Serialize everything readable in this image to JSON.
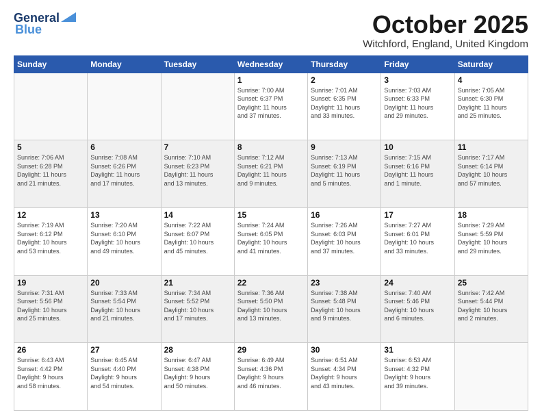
{
  "logo": {
    "line1": "General",
    "line2": "Blue"
  },
  "header": {
    "month": "October 2025",
    "location": "Witchford, England, United Kingdom"
  },
  "weekdays": [
    "Sunday",
    "Monday",
    "Tuesday",
    "Wednesday",
    "Thursday",
    "Friday",
    "Saturday"
  ],
  "weeks": [
    [
      {
        "day": "",
        "info": ""
      },
      {
        "day": "",
        "info": ""
      },
      {
        "day": "",
        "info": ""
      },
      {
        "day": "1",
        "info": "Sunrise: 7:00 AM\nSunset: 6:37 PM\nDaylight: 11 hours\nand 37 minutes."
      },
      {
        "day": "2",
        "info": "Sunrise: 7:01 AM\nSunset: 6:35 PM\nDaylight: 11 hours\nand 33 minutes."
      },
      {
        "day": "3",
        "info": "Sunrise: 7:03 AM\nSunset: 6:33 PM\nDaylight: 11 hours\nand 29 minutes."
      },
      {
        "day": "4",
        "info": "Sunrise: 7:05 AM\nSunset: 6:30 PM\nDaylight: 11 hours\nand 25 minutes."
      }
    ],
    [
      {
        "day": "5",
        "info": "Sunrise: 7:06 AM\nSunset: 6:28 PM\nDaylight: 11 hours\nand 21 minutes."
      },
      {
        "day": "6",
        "info": "Sunrise: 7:08 AM\nSunset: 6:26 PM\nDaylight: 11 hours\nand 17 minutes."
      },
      {
        "day": "7",
        "info": "Sunrise: 7:10 AM\nSunset: 6:23 PM\nDaylight: 11 hours\nand 13 minutes."
      },
      {
        "day": "8",
        "info": "Sunrise: 7:12 AM\nSunset: 6:21 PM\nDaylight: 11 hours\nand 9 minutes."
      },
      {
        "day": "9",
        "info": "Sunrise: 7:13 AM\nSunset: 6:19 PM\nDaylight: 11 hours\nand 5 minutes."
      },
      {
        "day": "10",
        "info": "Sunrise: 7:15 AM\nSunset: 6:16 PM\nDaylight: 11 hours\nand 1 minute."
      },
      {
        "day": "11",
        "info": "Sunrise: 7:17 AM\nSunset: 6:14 PM\nDaylight: 10 hours\nand 57 minutes."
      }
    ],
    [
      {
        "day": "12",
        "info": "Sunrise: 7:19 AM\nSunset: 6:12 PM\nDaylight: 10 hours\nand 53 minutes."
      },
      {
        "day": "13",
        "info": "Sunrise: 7:20 AM\nSunset: 6:10 PM\nDaylight: 10 hours\nand 49 minutes."
      },
      {
        "day": "14",
        "info": "Sunrise: 7:22 AM\nSunset: 6:07 PM\nDaylight: 10 hours\nand 45 minutes."
      },
      {
        "day": "15",
        "info": "Sunrise: 7:24 AM\nSunset: 6:05 PM\nDaylight: 10 hours\nand 41 minutes."
      },
      {
        "day": "16",
        "info": "Sunrise: 7:26 AM\nSunset: 6:03 PM\nDaylight: 10 hours\nand 37 minutes."
      },
      {
        "day": "17",
        "info": "Sunrise: 7:27 AM\nSunset: 6:01 PM\nDaylight: 10 hours\nand 33 minutes."
      },
      {
        "day": "18",
        "info": "Sunrise: 7:29 AM\nSunset: 5:59 PM\nDaylight: 10 hours\nand 29 minutes."
      }
    ],
    [
      {
        "day": "19",
        "info": "Sunrise: 7:31 AM\nSunset: 5:56 PM\nDaylight: 10 hours\nand 25 minutes."
      },
      {
        "day": "20",
        "info": "Sunrise: 7:33 AM\nSunset: 5:54 PM\nDaylight: 10 hours\nand 21 minutes."
      },
      {
        "day": "21",
        "info": "Sunrise: 7:34 AM\nSunset: 5:52 PM\nDaylight: 10 hours\nand 17 minutes."
      },
      {
        "day": "22",
        "info": "Sunrise: 7:36 AM\nSunset: 5:50 PM\nDaylight: 10 hours\nand 13 minutes."
      },
      {
        "day": "23",
        "info": "Sunrise: 7:38 AM\nSunset: 5:48 PM\nDaylight: 10 hours\nand 9 minutes."
      },
      {
        "day": "24",
        "info": "Sunrise: 7:40 AM\nSunset: 5:46 PM\nDaylight: 10 hours\nand 6 minutes."
      },
      {
        "day": "25",
        "info": "Sunrise: 7:42 AM\nSunset: 5:44 PM\nDaylight: 10 hours\nand 2 minutes."
      }
    ],
    [
      {
        "day": "26",
        "info": "Sunrise: 6:43 AM\nSunset: 4:42 PM\nDaylight: 9 hours\nand 58 minutes."
      },
      {
        "day": "27",
        "info": "Sunrise: 6:45 AM\nSunset: 4:40 PM\nDaylight: 9 hours\nand 54 minutes."
      },
      {
        "day": "28",
        "info": "Sunrise: 6:47 AM\nSunset: 4:38 PM\nDaylight: 9 hours\nand 50 minutes."
      },
      {
        "day": "29",
        "info": "Sunrise: 6:49 AM\nSunset: 4:36 PM\nDaylight: 9 hours\nand 46 minutes."
      },
      {
        "day": "30",
        "info": "Sunrise: 6:51 AM\nSunset: 4:34 PM\nDaylight: 9 hours\nand 43 minutes."
      },
      {
        "day": "31",
        "info": "Sunrise: 6:53 AM\nSunset: 4:32 PM\nDaylight: 9 hours\nand 39 minutes."
      },
      {
        "day": "",
        "info": ""
      }
    ]
  ]
}
